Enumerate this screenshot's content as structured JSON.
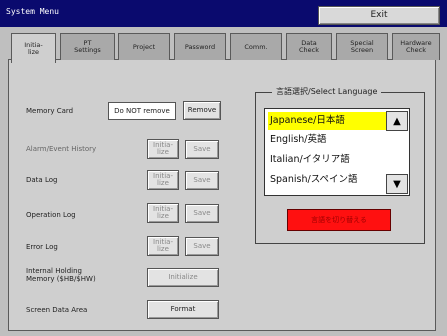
{
  "window": {
    "title": "System Menu",
    "exit_label": "Exit"
  },
  "tabs": [
    {
      "label": "Initia-\nlize",
      "active": true
    },
    {
      "label": "PT\nSettings"
    },
    {
      "label": "Project"
    },
    {
      "label": "Password"
    },
    {
      "label": "Comm."
    },
    {
      "label": "Data\nCheck"
    },
    {
      "label": "Special\nScreen"
    },
    {
      "label": "Hardware\nCheck"
    }
  ],
  "rows": {
    "memory_card": {
      "label": "Memory Card",
      "value": "Do NOT remove",
      "button": "Remove"
    },
    "alarm_history": {
      "label": "Alarm/Event History",
      "init": "Initia-\nlize",
      "save": "Save"
    },
    "data_log": {
      "label": "Data Log",
      "init": "Initia-\nlize",
      "save": "Save"
    },
    "operation_log": {
      "label": "Operation Log",
      "init": "Initia-\nlize",
      "save": "Save"
    },
    "error_log": {
      "label": "Error Log",
      "init": "Initia-\nlize",
      "save": "Save"
    },
    "internal_memory": {
      "label": "Internal Holding\nMemory ($HB/$HW)",
      "button": "Initialize"
    },
    "screen_data": {
      "label": "Screen Data Area",
      "button": "Format"
    }
  },
  "language": {
    "group_title": "言語選択/Select Language",
    "items": [
      "Japanese/日本語",
      "English/英語",
      "Italian/イタリア語",
      "Spanish/スペイン語"
    ],
    "selected_index": 0,
    "confirm_label": "言語を切り替える",
    "icons": {
      "up": "scroll-up-arrow-icon",
      "down": "scroll-down-arrow-icon"
    }
  },
  "colors": {
    "title_bar": "#0a0a6e",
    "selection": "#ffff00",
    "confirm": "#ff1010"
  }
}
